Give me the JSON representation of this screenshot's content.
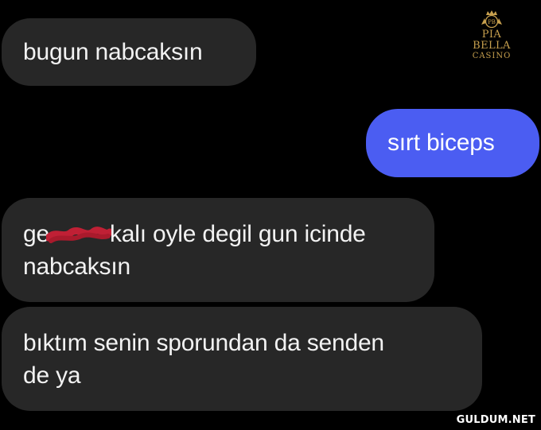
{
  "messages": [
    {
      "sender": "other",
      "lines": [
        "bugun nabcaksın"
      ]
    },
    {
      "sender": "me",
      "lines": [
        "sırt biceps"
      ]
    },
    {
      "sender": "other",
      "prefix": "ge",
      "suffix": "kalı oyle degil gun icinde",
      "lines": [
        "nabcaksın"
      ],
      "redacted": true
    },
    {
      "sender": "other",
      "lines": [
        "bıktım senin sporundan da senden",
        "de ya"
      ]
    }
  ],
  "logo": {
    "brand": "PIA BELLA",
    "sub": "CASINO",
    "monogram": "PB",
    "color": "#c7a04e"
  },
  "watermark": "GULDUM.NET",
  "colors": {
    "background": "#000000",
    "received_bubble": "#272727",
    "sent_bubble": "#4b5df2",
    "redaction_scribble": "#c02035"
  }
}
